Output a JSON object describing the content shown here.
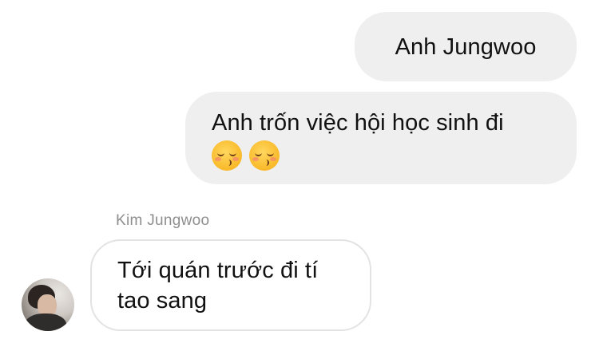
{
  "conversation": {
    "messages": [
      {
        "direction": "outgoing",
        "lines": [
          "Anh Jungwoo"
        ]
      },
      {
        "direction": "outgoing",
        "lines": [
          "Anh trốn việc hội học sinh đi"
        ],
        "emojis": [
          "kissing-face-with-smiling-eyes",
          "kissing-face-with-smiling-eyes"
        ]
      },
      {
        "direction": "incoming",
        "sender": "Kim Jungwoo",
        "lines": [
          "Tới quán trước đi tí",
          "tao sang"
        ]
      }
    ]
  },
  "colors": {
    "outgoing_bubble": "#efefef",
    "incoming_border": "#e3e3e3",
    "sender_name": "#8e8e8e",
    "text": "#111111"
  }
}
